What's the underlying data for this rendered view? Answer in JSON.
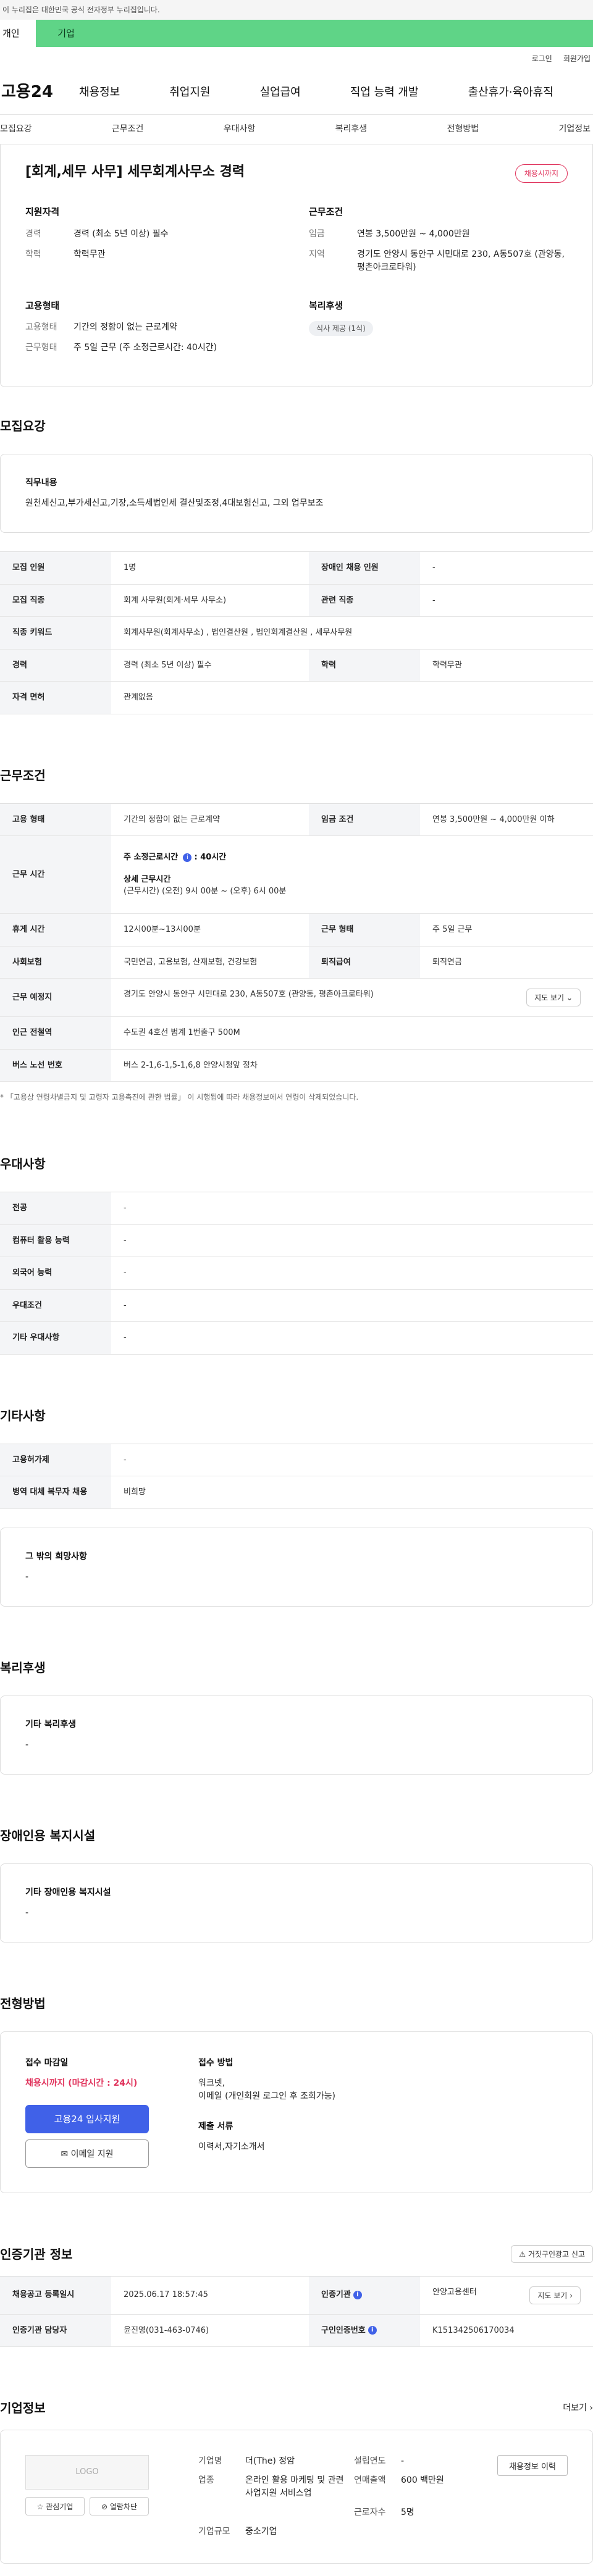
{
  "topbar": {
    "notice": "이 누리집은 대한민국 공식 전자정부 누리집입니다."
  },
  "tabs": {
    "person": "개인",
    "company": "기업"
  },
  "util": {
    "login": "로그인",
    "signup": "회원가입"
  },
  "gnb": {
    "logo": "고용24",
    "items": [
      "채용정보",
      "취업지원",
      "실업급여",
      "직업 능력 개발",
      "출산휴가·육아휴직"
    ]
  },
  "subnav": [
    "모집요강",
    "근무조건",
    "우대사항",
    "복리후생",
    "전형방법",
    "기업정보"
  ],
  "summary": {
    "title": "[회계,세무 사무] 세무회계사무소 경력",
    "badge": "채용시까지",
    "qual_title": "지원자격",
    "qual": [
      {
        "k": "경력",
        "v": "경력 (최소 5년 이상) 필수"
      },
      {
        "k": "학력",
        "v": "학력무관"
      }
    ],
    "cond_title": "근무조건",
    "cond": [
      {
        "k": "임금",
        "v": "연봉 3,500만원 ~ 4,000만원"
      },
      {
        "k": "지역",
        "v": "경기도 안양시 동안구 시민대로 230, A동507호 (관양동, 평촌아크로타워)"
      }
    ],
    "type_title": "고용형태",
    "type": [
      {
        "k": "고용형태",
        "v": "기간의 정함이 없는 근로계약"
      },
      {
        "k": "근무형태",
        "v": "주 5일 근무 (주 소정근로시간: 40시간)"
      }
    ],
    "welfare_title": "복리후생",
    "welfare_chip": "식사 제공 (1식)"
  },
  "recruit": {
    "title": "모집요강",
    "duty_title": "직무내용",
    "duty": "원천세신고,부가세신고,기장,소득세법인세 결산및조정,4대보험신고, 그외 업무보조",
    "rows": [
      {
        "k1": "모집 인원",
        "v1": "1명",
        "k2": "장애인 채용 인원",
        "v2": "-"
      },
      {
        "k1": "모집 직종",
        "v1": "회계 사무원(회계·세무 사무소)",
        "k2": "관련 직종",
        "v2": "-"
      }
    ],
    "keyword_k": "직종 키워드",
    "keyword_v": "회계사무원(회계사무소) , 법인결산원 , 법인회계결산원 , 세무사무원",
    "career_k": "경력",
    "career_v": "경력 (최소 5년 이상) 필수",
    "edu_k": "학력",
    "edu_v": "학력무관",
    "license_k": "자격 면허",
    "license_v": "관계없음"
  },
  "work": {
    "title": "근무조건",
    "type_k": "고용 형태",
    "type_v": "기간의 정함이 없는 근로계약",
    "wage_k": "임금 조건",
    "wage_v": "연봉 3,500만원 ~ 4,000만원 이하",
    "hours_k": "근무 시간",
    "hours_label": "주 소정근로시간",
    "hours_value": ": 40시간",
    "detail_label": "상세 근무시간",
    "detail_value": "(근무시간) (오전) 9시 00분 ~ (오후) 6시 00분",
    "break_k": "휴게 시간",
    "break_v": "12시00분~13시00분",
    "shift_k": "근무 형태",
    "shift_v": "주 5일 근무",
    "ins_k": "사회보험",
    "ins_v": "국민연금, 고용보험, 산재보험, 건강보험",
    "sev_k": "퇴직급여",
    "sev_v": "퇴직연금",
    "place_k": "근무 예정지",
    "place_v": "경기도 안양시 동안구 시민대로 230, A동507호 (관양동, 평촌아크로타워)",
    "map_btn": "지도 보기",
    "station_k": "인근 전철역",
    "station_v": "수도권 4호선 범계 1번출구 500M",
    "bus_k": "버스 노선 번호",
    "bus_v": "버스 2-1,6-1,5-1,6,8 안양시청앞 정차",
    "note": "* 「고용상 연령차별금지 및 고령자 고용촉진에 관한 법률」 이 시행됨에 따라 채용정보에서 연령이 삭제되었습니다."
  },
  "pref": {
    "title": "우대사항",
    "rows": [
      {
        "k": "전공",
        "v": "-"
      },
      {
        "k": "컴퓨터 활용 능력",
        "v": "-"
      },
      {
        "k": "외국어 능력",
        "v": "-"
      },
      {
        "k": "우대조건",
        "v": "-"
      },
      {
        "k": "기타 우대사항",
        "v": "-"
      }
    ]
  },
  "etc": {
    "title": "기타사항",
    "rows": [
      {
        "k": "고용허가제",
        "v": "-"
      },
      {
        "k": "병역 대체 복무자 채용",
        "v": "비희망"
      }
    ],
    "other_title": "그 밖의 희망사항",
    "other_v": "-"
  },
  "welfare": {
    "title": "복리후생",
    "box_title": "기타 복리후생",
    "box_v": "-"
  },
  "disabled": {
    "title": "장애인용 복지시설",
    "box_title": "기타 장애인용 복지시설",
    "box_v": "-"
  },
  "selection": {
    "title": "전형방법",
    "deadline_title": "접수 마감일",
    "deadline": "채용시까지 (마감시간 : 24시)",
    "btn_apply": "고용24 입사지원",
    "btn_email": "이메일 지원",
    "method_title": "접수 방법",
    "method": [
      "워크넷,",
      "이메일 (개인회원 로그인 후 조회가능)"
    ],
    "docs_title": "제출 서류",
    "docs": "이력서,자기소개서"
  },
  "agency": {
    "title": "인증기관 정보",
    "report_btn": "거짓구인광고 신고",
    "reg_k": "채용공고 등록일시",
    "reg_v": "2025.06.17 18:57:45",
    "org_k": "인증기관",
    "org_v": "안양고용센터",
    "map_btn": "지도 보기",
    "staff_k": "인증기관 담당자",
    "staff_v": "윤진영(031-463-0746)",
    "id_k": "구인인증번호",
    "id_v": "K151342506170034"
  },
  "company": {
    "title": "기업정보",
    "more": "더보기",
    "logo_text": "LOGO",
    "fav_btn": "관심기업",
    "block_btn": "열람차단",
    "name_k": "기업명",
    "name_v": "더(The) 정암",
    "found_k": "설립연도",
    "found_v": "-",
    "biz_k": "업종",
    "biz_v": "온라인 활용 마케팅 및 관련 사업지원 서비스업",
    "sales_k": "연매출액",
    "sales_v": "600 백만원",
    "emp_k": "근로자수",
    "emp_v": "5명",
    "size_k": "기업규모",
    "size_v": "중소기업",
    "history_btn": "채용정보 이력"
  }
}
